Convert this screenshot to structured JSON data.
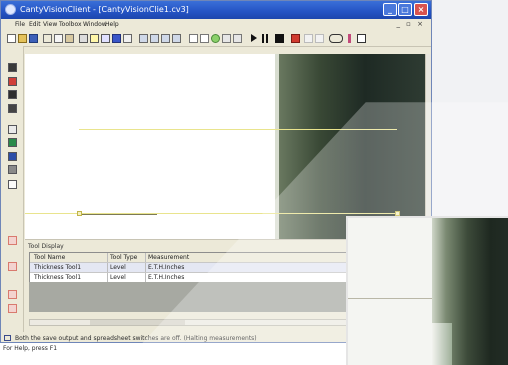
{
  "window": {
    "title": "CantyVisionClient - [CantyVisionClie1.cv3]",
    "controls": [
      "_",
      "□",
      "×"
    ]
  },
  "menubar": {
    "items": [
      "File",
      "Edit",
      "View",
      "Toolbox",
      "Window",
      "Help"
    ],
    "mdi_controls": "_ ▫ ×"
  },
  "colors": {
    "titlebar": "#2453c4",
    "measure_line": "#e9e48d",
    "close_button": "#d9534f"
  },
  "tool_display": {
    "title": "Tool Display",
    "columns": [
      "Tool Name",
      "Tool Type",
      "Measurement"
    ],
    "rows": [
      [
        "Thickness Tool1",
        "Level",
        "E.T.H.Inches"
      ],
      [
        "Thickness Tool1",
        "Level",
        "E.T.H.Inches"
      ]
    ]
  },
  "status": {
    "message": "Both the save output and spreadsheet switches are off. (Halting measurements)",
    "help": "For Help, press F1"
  }
}
